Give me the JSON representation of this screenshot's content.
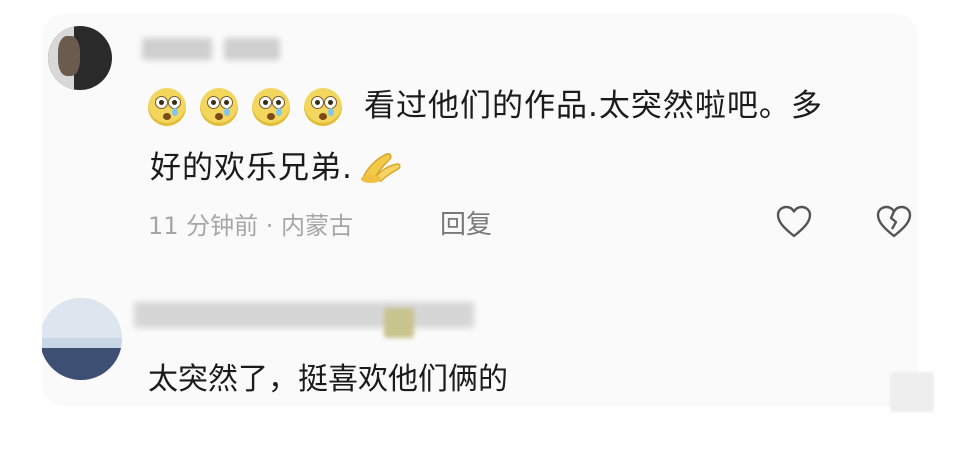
{
  "comment1": {
    "emoji_count": 4,
    "emoji_icon": "surprised-face-emoji-icon",
    "text_line1": "看过他们的作品.太突然啦吧。多",
    "text_line2": "好的欢乐兄弟.",
    "trailing_icon": "hand-wave-icon",
    "time_location": "11 分钟前 · 内蒙古",
    "reply_label": "回复"
  },
  "comment2": {
    "text": "太突然了，挺喜欢他们俩的"
  },
  "actions": {
    "like_icon": "heart-icon",
    "dislike_icon": "broken-heart-icon"
  },
  "colors": {
    "text": "#1b1b1b",
    "meta": "#a6a6a6",
    "emoji": "#f3d65d"
  }
}
